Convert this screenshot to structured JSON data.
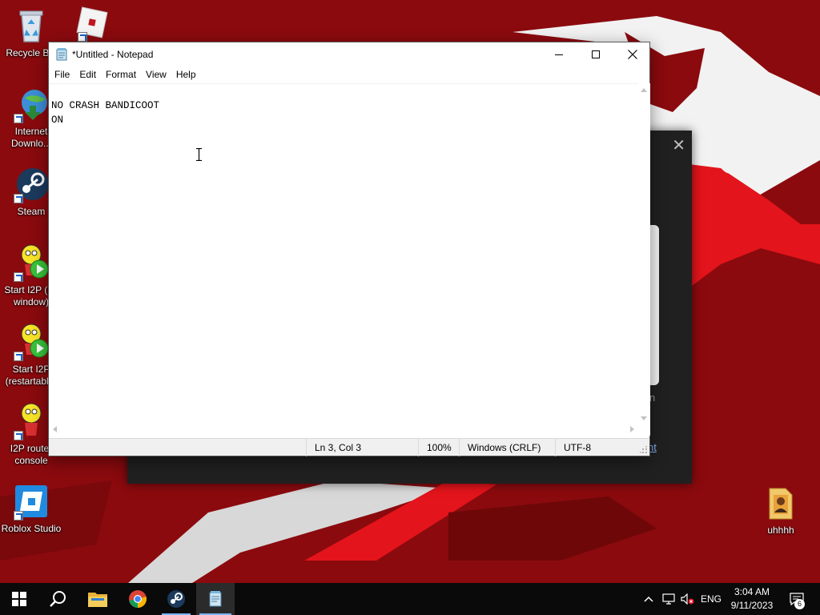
{
  "desktop": {
    "icons": [
      {
        "label": "Recycle Bin",
        "icon": "recycle-bin-icon"
      },
      {
        "label": "",
        "icon": "roblox-player-icon"
      },
      {
        "label": "Internet Downlo...",
        "icon": "internet-download-manager-icon"
      },
      {
        "label": "Steam",
        "icon": "steam-icon"
      },
      {
        "label": "Start I2P (no window)",
        "icon": "i2p-start-icon"
      },
      {
        "label": "Start I2P (restartable)",
        "icon": "i2p-restartable-icon"
      },
      {
        "label": "I2P router console",
        "icon": "i2p-console-icon"
      },
      {
        "label": "Roblox Studio",
        "icon": "roblox-studio-icon"
      },
      {
        "label": "uhhhh",
        "icon": "folder-icon"
      }
    ]
  },
  "background_dialog": {
    "close_glyph": "✕",
    "partial_text": "n",
    "partial_link": "nt"
  },
  "notepad": {
    "title": "*Untitled - Notepad",
    "menu": [
      "File",
      "Edit",
      "Format",
      "View",
      "Help"
    ],
    "content_lines": [
      "NO CRASH BANDICOOT",
      "ON",
      ""
    ],
    "status": {
      "position": "Ln 3, Col 3",
      "zoom": "100%",
      "line_ending": "Windows (CRLF)",
      "encoding": "UTF-8"
    }
  },
  "taskbar": {
    "pinned": [
      {
        "name": "start",
        "icon": "windows-start-icon"
      },
      {
        "name": "search",
        "icon": "search-icon"
      },
      {
        "name": "file-explorer",
        "icon": "folder-icon"
      },
      {
        "name": "chrome",
        "icon": "chrome-icon"
      },
      {
        "name": "steam",
        "icon": "steam-icon"
      },
      {
        "name": "notepad",
        "icon": "notepad-icon"
      }
    ],
    "tray": {
      "language": "ENG",
      "time": "3:04 AM",
      "date": "9/11/2023",
      "notification_count": "6"
    }
  },
  "colors": {
    "wallpaper_red": "#8b0a0e",
    "accent_red": "#e3141b",
    "taskbar": "#0a0a0a",
    "active_indicator": "#7ab4ff"
  }
}
